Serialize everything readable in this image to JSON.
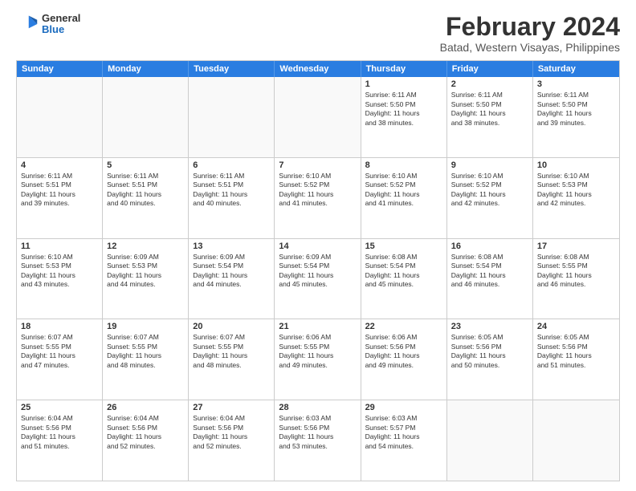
{
  "logo": {
    "general": "General",
    "blue": "Blue"
  },
  "title": "February 2024",
  "subtitle": "Batad, Western Visayas, Philippines",
  "days": [
    "Sunday",
    "Monday",
    "Tuesday",
    "Wednesday",
    "Thursday",
    "Friday",
    "Saturday"
  ],
  "weeks": [
    [
      {
        "day": "",
        "info": ""
      },
      {
        "day": "",
        "info": ""
      },
      {
        "day": "",
        "info": ""
      },
      {
        "day": "",
        "info": ""
      },
      {
        "day": "1",
        "info": "Sunrise: 6:11 AM\nSunset: 5:50 PM\nDaylight: 11 hours\nand 38 minutes."
      },
      {
        "day": "2",
        "info": "Sunrise: 6:11 AM\nSunset: 5:50 PM\nDaylight: 11 hours\nand 38 minutes."
      },
      {
        "day": "3",
        "info": "Sunrise: 6:11 AM\nSunset: 5:50 PM\nDaylight: 11 hours\nand 39 minutes."
      }
    ],
    [
      {
        "day": "4",
        "info": "Sunrise: 6:11 AM\nSunset: 5:51 PM\nDaylight: 11 hours\nand 39 minutes."
      },
      {
        "day": "5",
        "info": "Sunrise: 6:11 AM\nSunset: 5:51 PM\nDaylight: 11 hours\nand 40 minutes."
      },
      {
        "day": "6",
        "info": "Sunrise: 6:11 AM\nSunset: 5:51 PM\nDaylight: 11 hours\nand 40 minutes."
      },
      {
        "day": "7",
        "info": "Sunrise: 6:10 AM\nSunset: 5:52 PM\nDaylight: 11 hours\nand 41 minutes."
      },
      {
        "day": "8",
        "info": "Sunrise: 6:10 AM\nSunset: 5:52 PM\nDaylight: 11 hours\nand 41 minutes."
      },
      {
        "day": "9",
        "info": "Sunrise: 6:10 AM\nSunset: 5:52 PM\nDaylight: 11 hours\nand 42 minutes."
      },
      {
        "day": "10",
        "info": "Sunrise: 6:10 AM\nSunset: 5:53 PM\nDaylight: 11 hours\nand 42 minutes."
      }
    ],
    [
      {
        "day": "11",
        "info": "Sunrise: 6:10 AM\nSunset: 5:53 PM\nDaylight: 11 hours\nand 43 minutes."
      },
      {
        "day": "12",
        "info": "Sunrise: 6:09 AM\nSunset: 5:53 PM\nDaylight: 11 hours\nand 44 minutes."
      },
      {
        "day": "13",
        "info": "Sunrise: 6:09 AM\nSunset: 5:54 PM\nDaylight: 11 hours\nand 44 minutes."
      },
      {
        "day": "14",
        "info": "Sunrise: 6:09 AM\nSunset: 5:54 PM\nDaylight: 11 hours\nand 45 minutes."
      },
      {
        "day": "15",
        "info": "Sunrise: 6:08 AM\nSunset: 5:54 PM\nDaylight: 11 hours\nand 45 minutes."
      },
      {
        "day": "16",
        "info": "Sunrise: 6:08 AM\nSunset: 5:54 PM\nDaylight: 11 hours\nand 46 minutes."
      },
      {
        "day": "17",
        "info": "Sunrise: 6:08 AM\nSunset: 5:55 PM\nDaylight: 11 hours\nand 46 minutes."
      }
    ],
    [
      {
        "day": "18",
        "info": "Sunrise: 6:07 AM\nSunset: 5:55 PM\nDaylight: 11 hours\nand 47 minutes."
      },
      {
        "day": "19",
        "info": "Sunrise: 6:07 AM\nSunset: 5:55 PM\nDaylight: 11 hours\nand 48 minutes."
      },
      {
        "day": "20",
        "info": "Sunrise: 6:07 AM\nSunset: 5:55 PM\nDaylight: 11 hours\nand 48 minutes."
      },
      {
        "day": "21",
        "info": "Sunrise: 6:06 AM\nSunset: 5:55 PM\nDaylight: 11 hours\nand 49 minutes."
      },
      {
        "day": "22",
        "info": "Sunrise: 6:06 AM\nSunset: 5:56 PM\nDaylight: 11 hours\nand 49 minutes."
      },
      {
        "day": "23",
        "info": "Sunrise: 6:05 AM\nSunset: 5:56 PM\nDaylight: 11 hours\nand 50 minutes."
      },
      {
        "day": "24",
        "info": "Sunrise: 6:05 AM\nSunset: 5:56 PM\nDaylight: 11 hours\nand 51 minutes."
      }
    ],
    [
      {
        "day": "25",
        "info": "Sunrise: 6:04 AM\nSunset: 5:56 PM\nDaylight: 11 hours\nand 51 minutes."
      },
      {
        "day": "26",
        "info": "Sunrise: 6:04 AM\nSunset: 5:56 PM\nDaylight: 11 hours\nand 52 minutes."
      },
      {
        "day": "27",
        "info": "Sunrise: 6:04 AM\nSunset: 5:56 PM\nDaylight: 11 hours\nand 52 minutes."
      },
      {
        "day": "28",
        "info": "Sunrise: 6:03 AM\nSunset: 5:56 PM\nDaylight: 11 hours\nand 53 minutes."
      },
      {
        "day": "29",
        "info": "Sunrise: 6:03 AM\nSunset: 5:57 PM\nDaylight: 11 hours\nand 54 minutes."
      },
      {
        "day": "",
        "info": ""
      },
      {
        "day": "",
        "info": ""
      }
    ]
  ]
}
